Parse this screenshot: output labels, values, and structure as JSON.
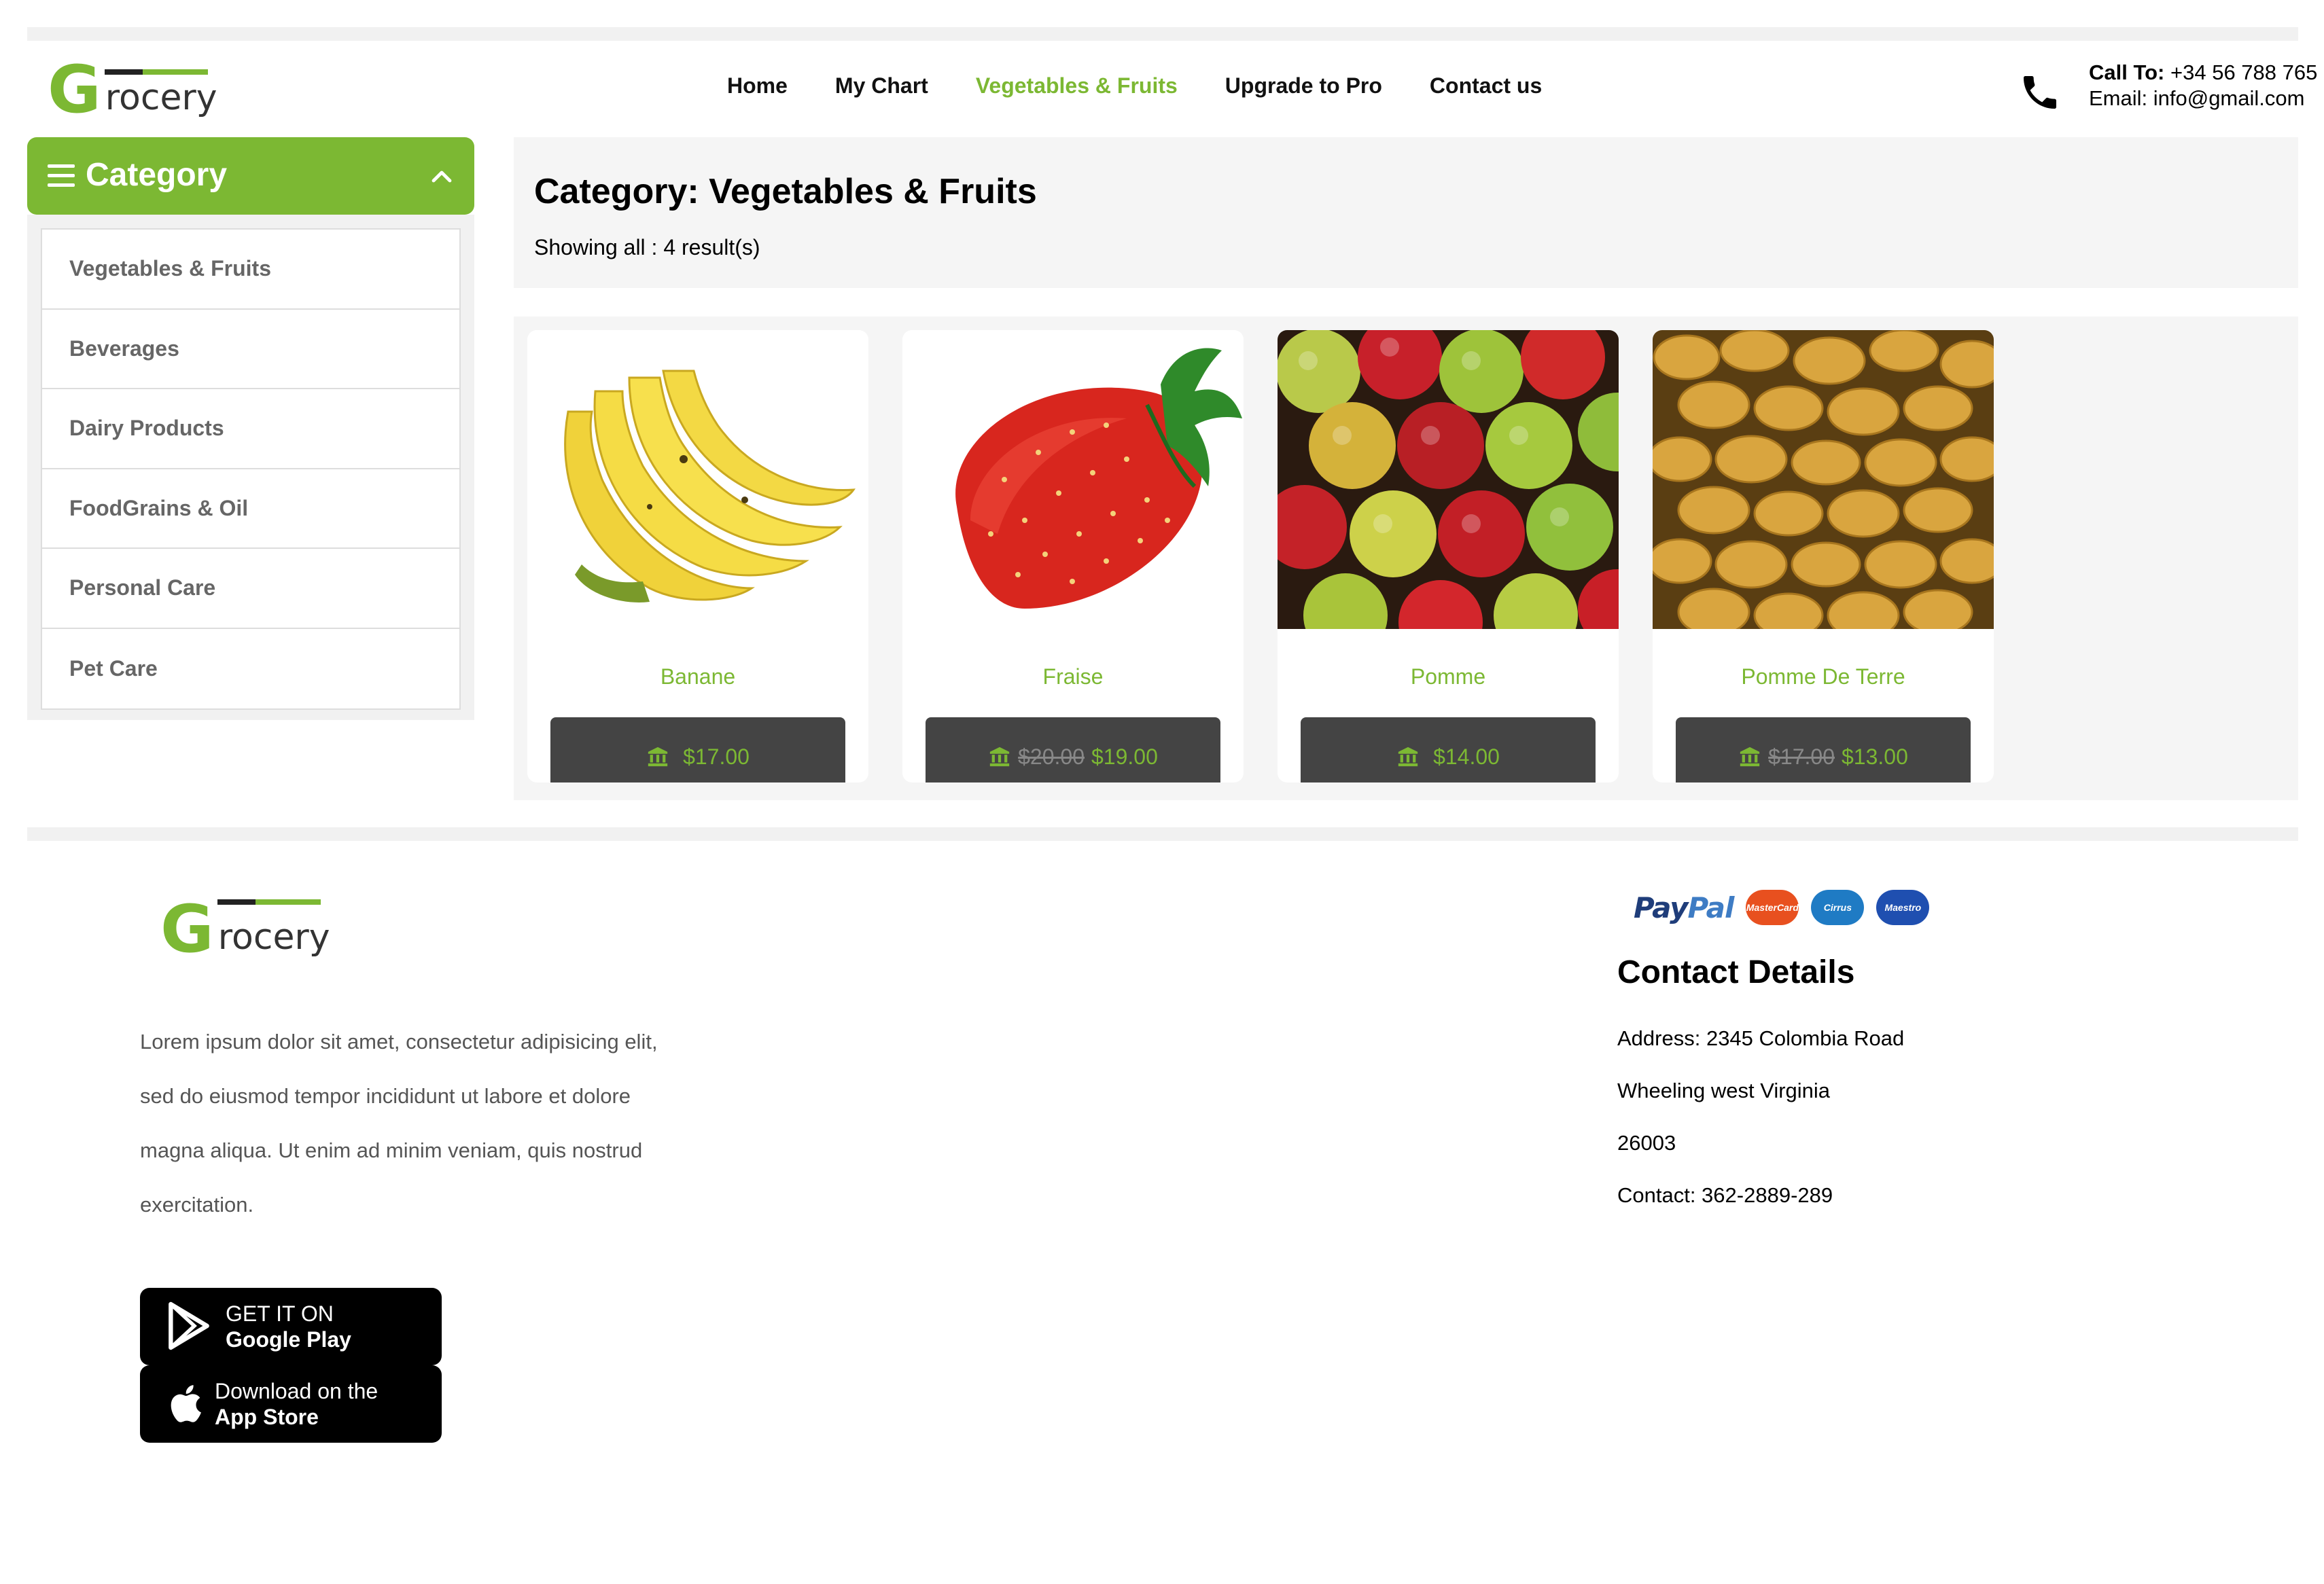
{
  "brand": {
    "logo_initial": "G",
    "logo_rest": "rocery",
    "accent": "#7cb833",
    "dark_button": "#444444"
  },
  "nav": {
    "items": [
      {
        "label": "Home",
        "active": false
      },
      {
        "label": "My Chart",
        "active": false
      },
      {
        "label": "Vegetables & Fruits",
        "active": true
      },
      {
        "label": "Upgrade to Pro",
        "active": false
      },
      {
        "label": "Contact us",
        "active": false
      }
    ]
  },
  "header_contact": {
    "call_label": "Call To:",
    "call_value": "+34 56 788 765",
    "email_line": "Email: info@gmail.com",
    "icon": "phone-icon"
  },
  "sidebar": {
    "title": "Category",
    "items": [
      {
        "label": "Vegetables & Fruits"
      },
      {
        "label": "Beverages"
      },
      {
        "label": "Dairy Products"
      },
      {
        "label": "FoodGrains & Oil"
      },
      {
        "label": "Personal Care"
      },
      {
        "label": "Pet Care"
      }
    ]
  },
  "main": {
    "title": "Category: Vegetables & Fruits",
    "result_count": "Showing all : 4 result(s)"
  },
  "products": [
    {
      "name": "Banane",
      "old_price": "",
      "price": "$17.00",
      "image": "banana"
    },
    {
      "name": "Fraise",
      "old_price": "$20.00",
      "price": "$19.00",
      "image": "strawberry"
    },
    {
      "name": "Pomme",
      "old_price": "",
      "price": "$14.00",
      "image": "apples"
    },
    {
      "name": "Pomme De Terre",
      "old_price": "$17.00",
      "price": "$13.00",
      "image": "potatoes"
    }
  ],
  "footer": {
    "about_lines": [
      "Lorem ipsum dolor sit amet, consectetur adipisicing elit,",
      "sed do eiusmod tempor incididunt ut labore et dolore",
      "magna aliqua. Ut enim ad minim veniam, quis nostrud",
      "exercitation."
    ],
    "google_play": {
      "line1": "GET IT ON",
      "line2": "Google Play"
    },
    "app_store": {
      "line1": "Download on the",
      "line2": "App Store"
    },
    "payments": {
      "paypal_a": "Pay",
      "paypal_b": "Pal",
      "cards": [
        {
          "label": "MasterCard",
          "color": "#e8501f"
        },
        {
          "label": "Cirrus",
          "color": "#1f7bc4"
        },
        {
          "label": "Maestro",
          "color": "#1f4fb0"
        }
      ]
    },
    "contact_title": "Contact Details",
    "contact_lines": [
      "Address: 2345 Colombia Road",
      "Wheeling west Virginia",
      "26003",
      "Contact: 362-2889-289"
    ]
  }
}
